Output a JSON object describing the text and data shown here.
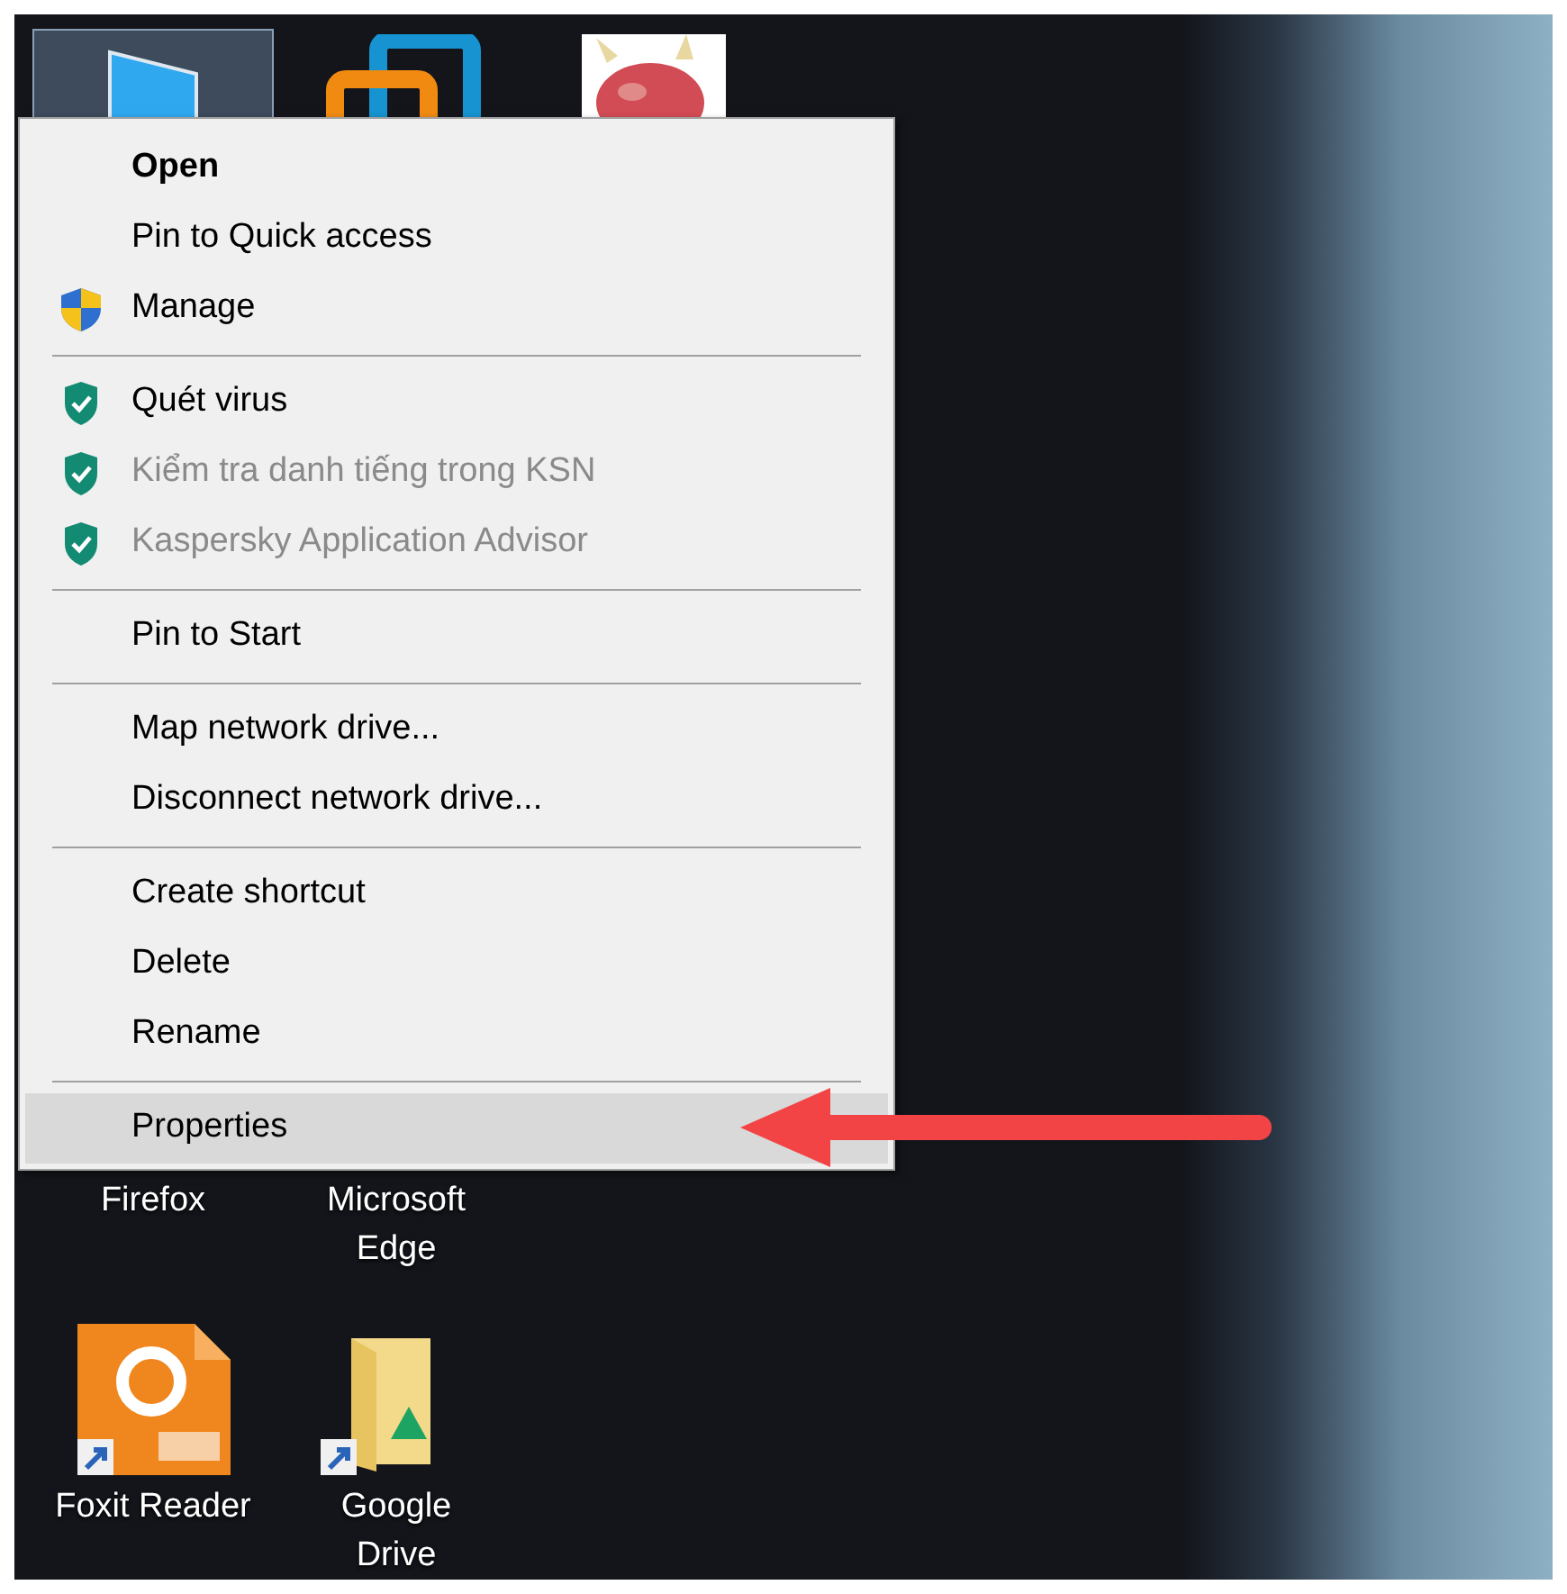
{
  "desktop": {
    "top_icons": [
      {
        "kind": "monitor",
        "selected": true
      },
      {
        "kind": "app",
        "selected": false
      },
      {
        "kind": "picture",
        "selected": false
      }
    ],
    "icons": [
      {
        "kind": "hidden",
        "label": "Firefox"
      },
      {
        "kind": "hidden",
        "label": "Microsoft Edge"
      },
      {
        "kind": "pdf",
        "label": "Foxit Reader"
      },
      {
        "kind": "drive-folder",
        "label": "Google Drive"
      }
    ]
  },
  "context_menu": {
    "items": [
      {
        "kind": "item",
        "label": "Open",
        "default": true,
        "disabled": false,
        "selected": false
      },
      {
        "kind": "item",
        "label": "Pin to Quick access",
        "default": false,
        "disabled": false,
        "selected": false
      },
      {
        "kind": "uac",
        "label": "Manage",
        "default": false,
        "disabled": false,
        "selected": false
      },
      {
        "kind": "separator"
      },
      {
        "kind": "av",
        "label": "Quét virus",
        "default": false,
        "disabled": false,
        "selected": false
      },
      {
        "kind": "av",
        "label": "Kiểm tra danh tiếng trong KSN",
        "default": false,
        "disabled": true,
        "selected": false
      },
      {
        "kind": "av",
        "label": "Kaspersky Application Advisor",
        "default": false,
        "disabled": true,
        "selected": false
      },
      {
        "kind": "separator"
      },
      {
        "kind": "item",
        "label": "Pin to Start",
        "default": false,
        "disabled": false,
        "selected": false
      },
      {
        "kind": "separator"
      },
      {
        "kind": "item",
        "label": "Map network drive...",
        "default": false,
        "disabled": false,
        "selected": false
      },
      {
        "kind": "item",
        "label": "Disconnect network drive...",
        "default": false,
        "disabled": false,
        "selected": false
      },
      {
        "kind": "separator"
      },
      {
        "kind": "item",
        "label": "Create shortcut",
        "default": false,
        "disabled": false,
        "selected": false
      },
      {
        "kind": "item",
        "label": "Delete",
        "default": false,
        "disabled": false,
        "selected": false
      },
      {
        "kind": "item",
        "label": "Rename",
        "default": false,
        "disabled": false,
        "selected": false
      },
      {
        "kind": "separator"
      },
      {
        "kind": "item",
        "label": "Properties",
        "default": false,
        "disabled": false,
        "selected": true
      }
    ]
  }
}
